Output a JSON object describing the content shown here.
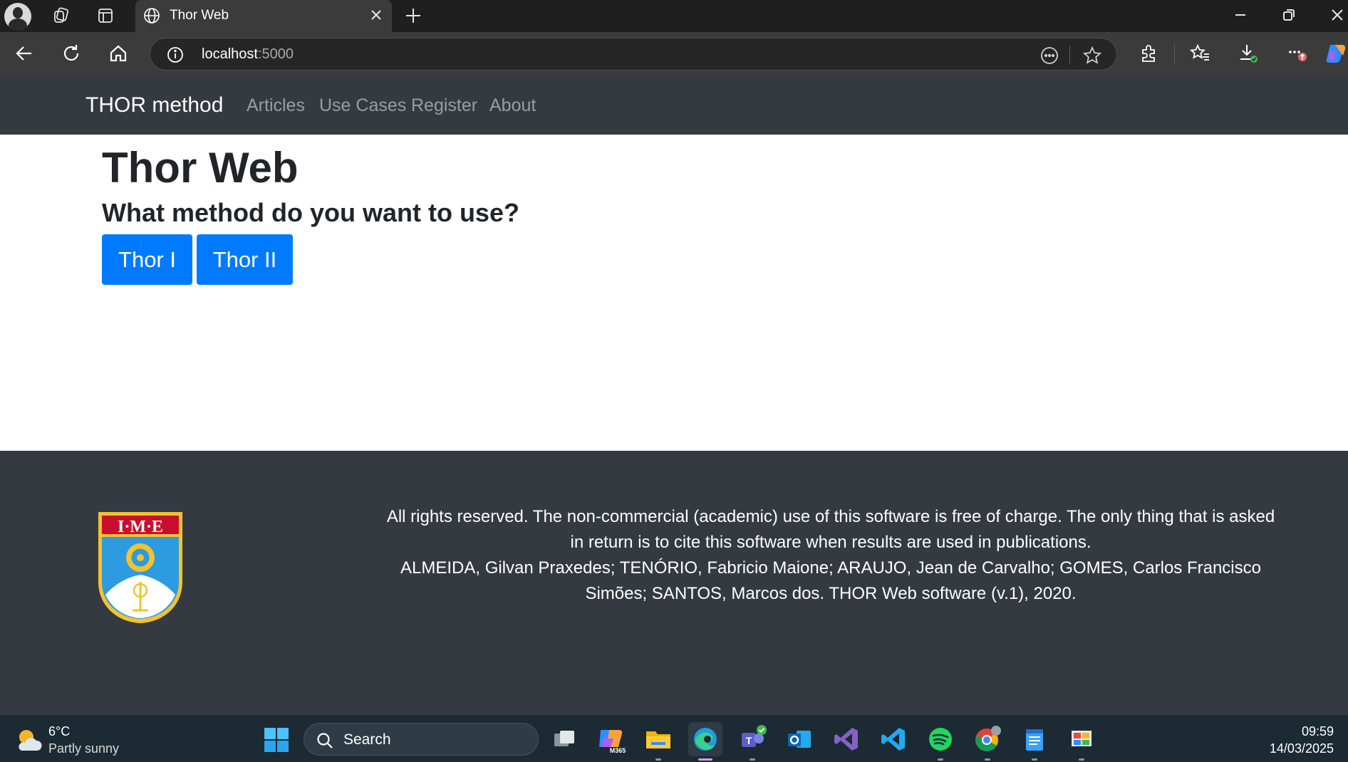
{
  "browser": {
    "tab_title": "Thor Web",
    "url_host": "localhost",
    "url_port": ":5000"
  },
  "navbar": {
    "brand": "THOR method",
    "links": [
      "Articles",
      "Use Cases",
      "Register",
      "About"
    ]
  },
  "main": {
    "title": "Thor Web",
    "question": "What method do you want to use?",
    "buttons": [
      "Thor I",
      "Thor II"
    ]
  },
  "footer": {
    "crest_text": "I·M·E",
    "line1": "All rights reserved. The non-commercial (academic) use of this software is free of charge. The only thing that is asked in return is to cite this software when results are used in publications.",
    "line2": "ALMEIDA, Gilvan Praxedes; TENÓRIO, Fabricio Maione; ARAUJO, Jean de Carvalho; GOMES, Carlos Francisco Simões; SANTOS, Marcos dos. THOR Web software (v.1), 2020."
  },
  "taskbar": {
    "weather_temp": "6°C",
    "weather_desc": "Partly sunny",
    "search_label": "Search",
    "m365_label": "M365",
    "time": "09:59",
    "date": "14/03/2025"
  },
  "colors": {
    "navbar_bg": "#343a40",
    "primary_button": "#007bff",
    "browser_chrome": "#1f1f1f"
  }
}
